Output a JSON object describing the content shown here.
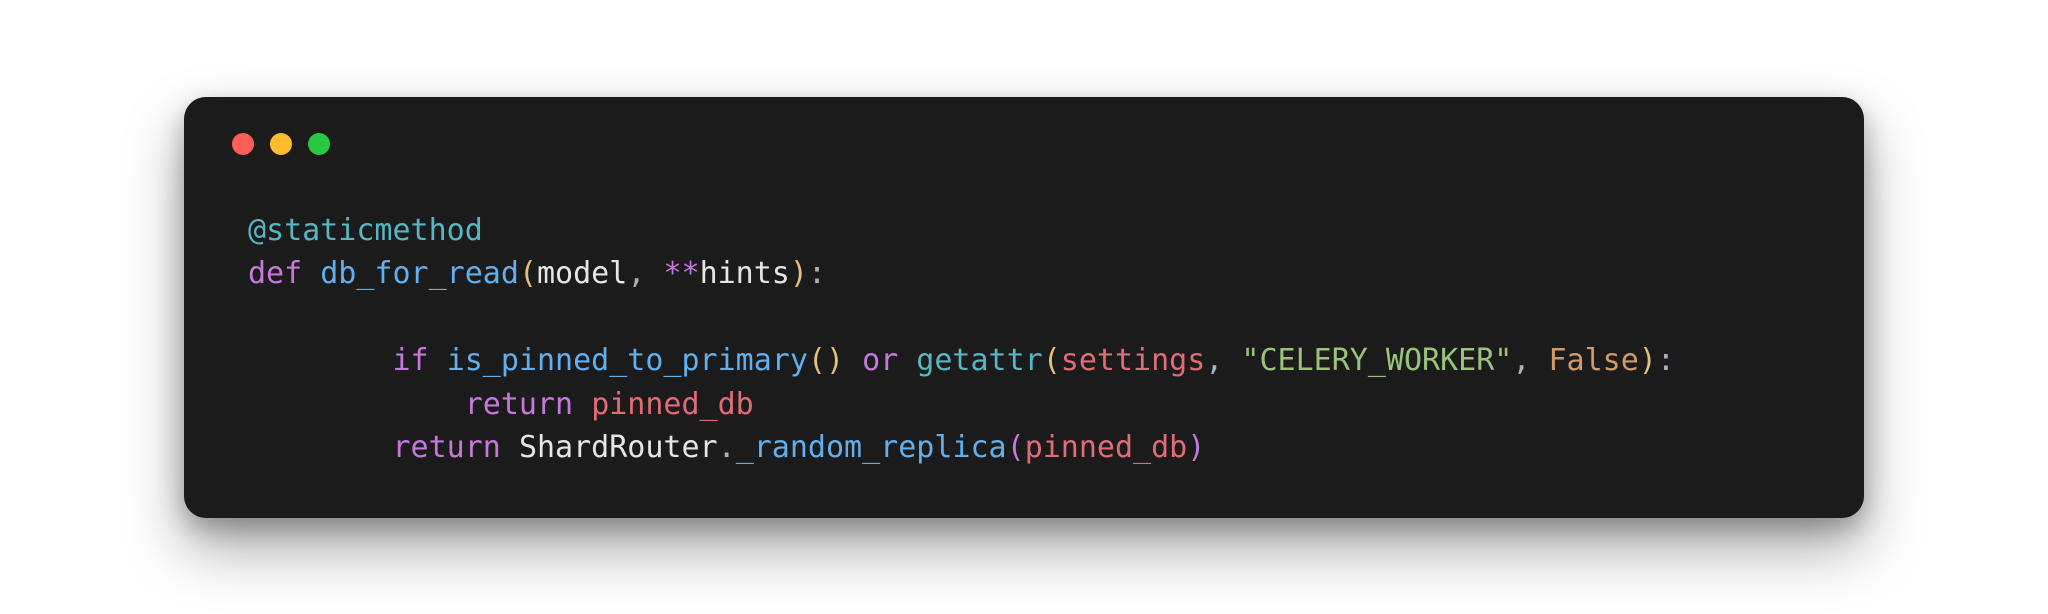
{
  "window": {
    "traffic_lights": {
      "close": "#ff5f57",
      "min": "#febc2e",
      "max": "#28c840"
    }
  },
  "code": {
    "indent1": "    ",
    "indent2": "        ",
    "indent3": "            ",
    "decorator_sym": "@",
    "decorator_name": "staticmethod",
    "kw_def": "def",
    "funcname": "db_for_read",
    "lp": "(",
    "rp": ")",
    "param1": "model",
    "comma_sp": ", ",
    "starstar": "**",
    "param2": "hints",
    "colon": ":",
    "kw_if": "if",
    "space": " ",
    "call1": "is_pinned_to_primary",
    "kw_or": "or",
    "builtin_getattr": "getattr",
    "ident_settings": "settings",
    "str_celery": "\"CELERY_WORKER\"",
    "const_false": "False",
    "kw_return": "return",
    "ident_pinned_db": "pinned_db",
    "cls_shardrouter": "ShardRouter",
    "dot": ".",
    "method_random_replica": "_random_replica"
  }
}
